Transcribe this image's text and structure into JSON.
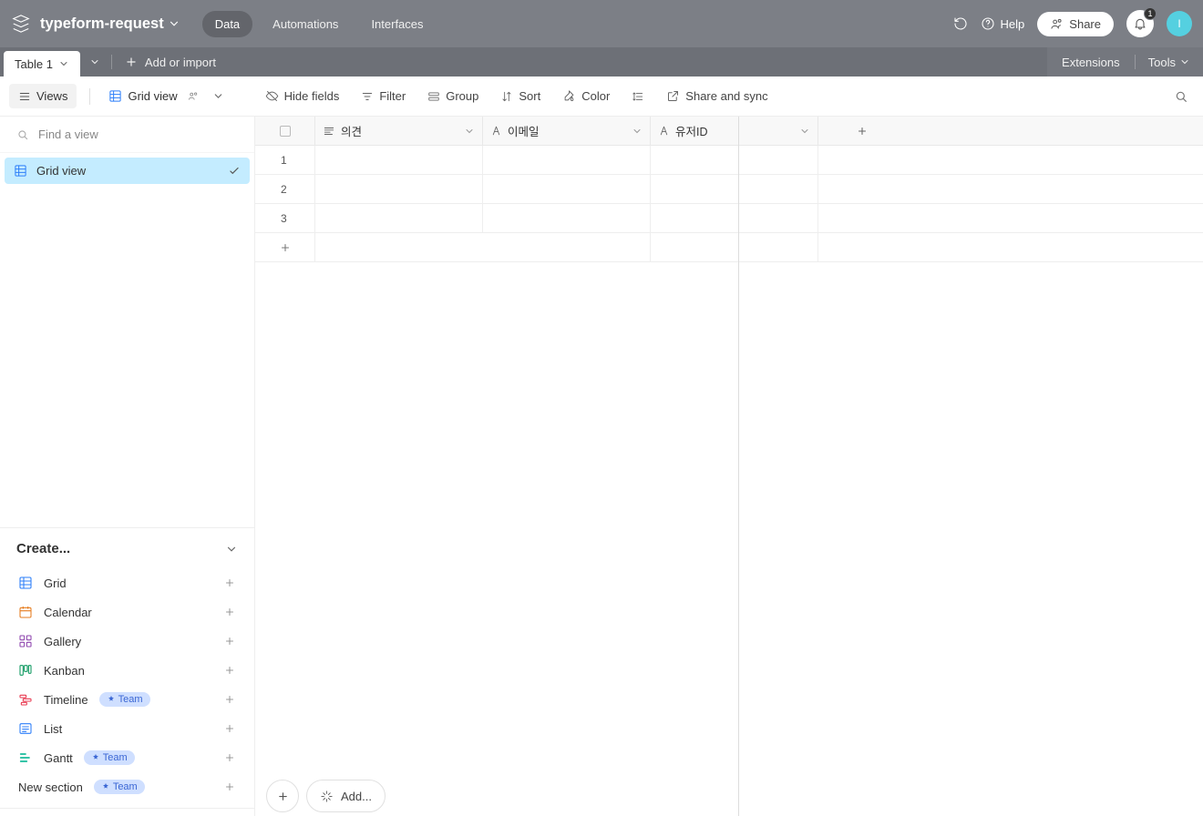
{
  "header": {
    "title": "typeform-request",
    "tabs": {
      "data": "Data",
      "automations": "Automations",
      "interfaces": "Interfaces"
    },
    "help": "Help",
    "share": "Share",
    "notification_count": "1",
    "avatar_initial": "I"
  },
  "tablebar": {
    "table_tab": "Table 1",
    "add_import": "Add or import",
    "extensions": "Extensions",
    "tools": "Tools"
  },
  "toolbar": {
    "views": "Views",
    "grid_view": "Grid view",
    "hide_fields": "Hide fields",
    "filter": "Filter",
    "group": "Group",
    "sort": "Sort",
    "color": "Color",
    "share_sync": "Share and sync"
  },
  "sidebar": {
    "find_placeholder": "Find a view",
    "views": [
      {
        "label": "Grid view"
      }
    ],
    "create_header": "Create...",
    "create_items": [
      {
        "label": "Grid",
        "team": false,
        "icon": "grid"
      },
      {
        "label": "Calendar",
        "team": false,
        "icon": "calendar"
      },
      {
        "label": "Gallery",
        "team": false,
        "icon": "gallery"
      },
      {
        "label": "Kanban",
        "team": false,
        "icon": "kanban"
      },
      {
        "label": "Timeline",
        "team": true,
        "icon": "timeline"
      },
      {
        "label": "List",
        "team": false,
        "icon": "list"
      },
      {
        "label": "Gantt",
        "team": true,
        "icon": "gantt"
      }
    ],
    "team_badge": "Team",
    "new_section": "New section"
  },
  "grid": {
    "columns": [
      {
        "label": "의견",
        "type": "long-text"
      },
      {
        "label": "이메일",
        "type": "text"
      },
      {
        "label": "유저ID",
        "type": "text"
      }
    ],
    "rows": [
      "1",
      "2",
      "3"
    ],
    "footer_add": "Add..."
  }
}
